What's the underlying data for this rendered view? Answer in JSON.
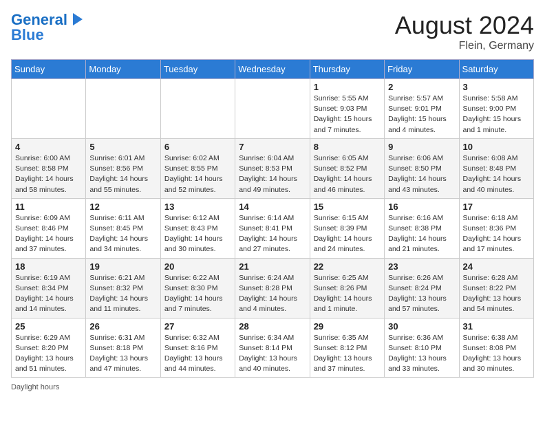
{
  "header": {
    "logo_general": "General",
    "logo_blue": "Blue",
    "title": "August 2024",
    "subtitle": "Flein, Germany"
  },
  "weekdays": [
    "Sunday",
    "Monday",
    "Tuesday",
    "Wednesday",
    "Thursday",
    "Friday",
    "Saturday"
  ],
  "weeks": [
    [
      {
        "day": "",
        "info": ""
      },
      {
        "day": "",
        "info": ""
      },
      {
        "day": "",
        "info": ""
      },
      {
        "day": "",
        "info": ""
      },
      {
        "day": "1",
        "info": "Sunrise: 5:55 AM\nSunset: 9:03 PM\nDaylight: 15 hours and 7 minutes."
      },
      {
        "day": "2",
        "info": "Sunrise: 5:57 AM\nSunset: 9:01 PM\nDaylight: 15 hours and 4 minutes."
      },
      {
        "day": "3",
        "info": "Sunrise: 5:58 AM\nSunset: 9:00 PM\nDaylight: 15 hours and 1 minute."
      }
    ],
    [
      {
        "day": "4",
        "info": "Sunrise: 6:00 AM\nSunset: 8:58 PM\nDaylight: 14 hours and 58 minutes."
      },
      {
        "day": "5",
        "info": "Sunrise: 6:01 AM\nSunset: 8:56 PM\nDaylight: 14 hours and 55 minutes."
      },
      {
        "day": "6",
        "info": "Sunrise: 6:02 AM\nSunset: 8:55 PM\nDaylight: 14 hours and 52 minutes."
      },
      {
        "day": "7",
        "info": "Sunrise: 6:04 AM\nSunset: 8:53 PM\nDaylight: 14 hours and 49 minutes."
      },
      {
        "day": "8",
        "info": "Sunrise: 6:05 AM\nSunset: 8:52 PM\nDaylight: 14 hours and 46 minutes."
      },
      {
        "day": "9",
        "info": "Sunrise: 6:06 AM\nSunset: 8:50 PM\nDaylight: 14 hours and 43 minutes."
      },
      {
        "day": "10",
        "info": "Sunrise: 6:08 AM\nSunset: 8:48 PM\nDaylight: 14 hours and 40 minutes."
      }
    ],
    [
      {
        "day": "11",
        "info": "Sunrise: 6:09 AM\nSunset: 8:46 PM\nDaylight: 14 hours and 37 minutes."
      },
      {
        "day": "12",
        "info": "Sunrise: 6:11 AM\nSunset: 8:45 PM\nDaylight: 14 hours and 34 minutes."
      },
      {
        "day": "13",
        "info": "Sunrise: 6:12 AM\nSunset: 8:43 PM\nDaylight: 14 hours and 30 minutes."
      },
      {
        "day": "14",
        "info": "Sunrise: 6:14 AM\nSunset: 8:41 PM\nDaylight: 14 hours and 27 minutes."
      },
      {
        "day": "15",
        "info": "Sunrise: 6:15 AM\nSunset: 8:39 PM\nDaylight: 14 hours and 24 minutes."
      },
      {
        "day": "16",
        "info": "Sunrise: 6:16 AM\nSunset: 8:38 PM\nDaylight: 14 hours and 21 minutes."
      },
      {
        "day": "17",
        "info": "Sunrise: 6:18 AM\nSunset: 8:36 PM\nDaylight: 14 hours and 17 minutes."
      }
    ],
    [
      {
        "day": "18",
        "info": "Sunrise: 6:19 AM\nSunset: 8:34 PM\nDaylight: 14 hours and 14 minutes."
      },
      {
        "day": "19",
        "info": "Sunrise: 6:21 AM\nSunset: 8:32 PM\nDaylight: 14 hours and 11 minutes."
      },
      {
        "day": "20",
        "info": "Sunrise: 6:22 AM\nSunset: 8:30 PM\nDaylight: 14 hours and 7 minutes."
      },
      {
        "day": "21",
        "info": "Sunrise: 6:24 AM\nSunset: 8:28 PM\nDaylight: 14 hours and 4 minutes."
      },
      {
        "day": "22",
        "info": "Sunrise: 6:25 AM\nSunset: 8:26 PM\nDaylight: 14 hours and 1 minute."
      },
      {
        "day": "23",
        "info": "Sunrise: 6:26 AM\nSunset: 8:24 PM\nDaylight: 13 hours and 57 minutes."
      },
      {
        "day": "24",
        "info": "Sunrise: 6:28 AM\nSunset: 8:22 PM\nDaylight: 13 hours and 54 minutes."
      }
    ],
    [
      {
        "day": "25",
        "info": "Sunrise: 6:29 AM\nSunset: 8:20 PM\nDaylight: 13 hours and 51 minutes."
      },
      {
        "day": "26",
        "info": "Sunrise: 6:31 AM\nSunset: 8:18 PM\nDaylight: 13 hours and 47 minutes."
      },
      {
        "day": "27",
        "info": "Sunrise: 6:32 AM\nSunset: 8:16 PM\nDaylight: 13 hours and 44 minutes."
      },
      {
        "day": "28",
        "info": "Sunrise: 6:34 AM\nSunset: 8:14 PM\nDaylight: 13 hours and 40 minutes."
      },
      {
        "day": "29",
        "info": "Sunrise: 6:35 AM\nSunset: 8:12 PM\nDaylight: 13 hours and 37 minutes."
      },
      {
        "day": "30",
        "info": "Sunrise: 6:36 AM\nSunset: 8:10 PM\nDaylight: 13 hours and 33 minutes."
      },
      {
        "day": "31",
        "info": "Sunrise: 6:38 AM\nSunset: 8:08 PM\nDaylight: 13 hours and 30 minutes."
      }
    ]
  ],
  "footer": {
    "note": "Daylight hours"
  }
}
